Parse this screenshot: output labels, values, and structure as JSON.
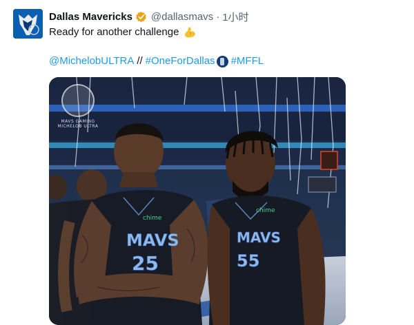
{
  "account": {
    "display_name": "Dallas Mavericks",
    "handle": "@dallasmavs",
    "separator": "·",
    "time": "1小时",
    "verified": true,
    "avatar_icon": "mavericks-logo-icon"
  },
  "tweet": {
    "text": "Ready for another challenge",
    "emoji": "flexed-biceps-icon",
    "tags": {
      "mention": "@MichelobULTRA",
      "separator": "//",
      "hashtag1": "#OneForDallas",
      "hashtag1_icon": "mavericks-ball-icon",
      "hashtag2": "#MFFL"
    }
  },
  "media": {
    "jersey_text_left": "MAVS",
    "jersey_number_left": "25",
    "jersey_text_right": "MAVS",
    "jersey_number_right": "55",
    "sponsor": "chime",
    "watermark_line1": "MAVS GAMING",
    "watermark_line2": "MICHELOB ULTRA"
  },
  "colors": {
    "link": "#1d9bf0",
    "verified_badge": "#e8a317",
    "secondary_text": "#536471",
    "primary_text": "#0f1419"
  }
}
